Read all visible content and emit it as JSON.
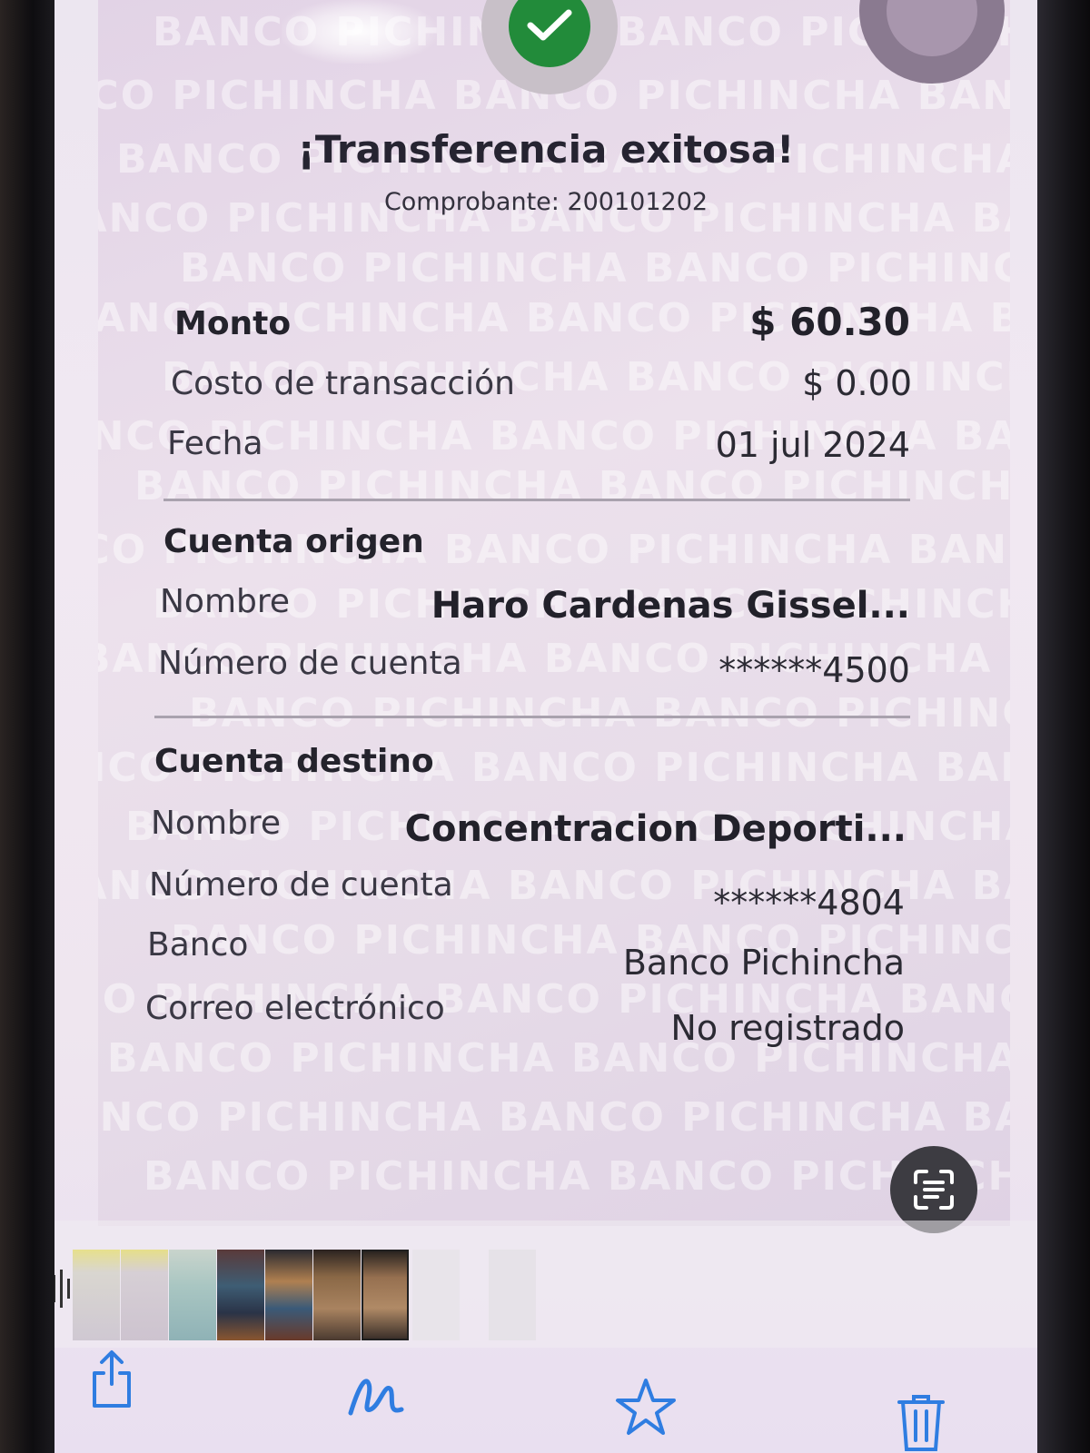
{
  "header": {
    "title": "¡Transferencia exitosa!",
    "voucher": "Comprobante: 200101202"
  },
  "summary": {
    "amount_label": "Monto",
    "amount_value": "$ 60.30",
    "fee_label": "Costo de transacción",
    "fee_value": "$ 0.00",
    "date_label": "Fecha",
    "date_value": "01 jul 2024"
  },
  "origin": {
    "section_title": "Cuenta origen",
    "name_label": "Nombre",
    "name_value": "Haro  Cardenas Gissel...",
    "account_label": "Número de cuenta",
    "account_value": "******4500"
  },
  "destination": {
    "section_title": "Cuenta destino",
    "name_label": "Nombre",
    "name_value": "Concentracion Deporti...",
    "account_label": "Número de cuenta",
    "account_value": "******4804",
    "bank_label": "Banco",
    "bank_value": "Banco Pichincha",
    "email_label": "Correo electrónico",
    "email_value": "No registrado"
  },
  "watermark_text": "BANCO PICHINCHA BANCO PICHINCHA BANCO PICHINCHA",
  "icons": {
    "success": "check-icon",
    "scan": "live-text-icon",
    "share": "share-icon",
    "markup": "markup-icon",
    "favorite": "star-icon",
    "delete": "trash-icon"
  },
  "colors": {
    "success_green": "#228b3a",
    "ios_blue": "#2f7de1"
  }
}
